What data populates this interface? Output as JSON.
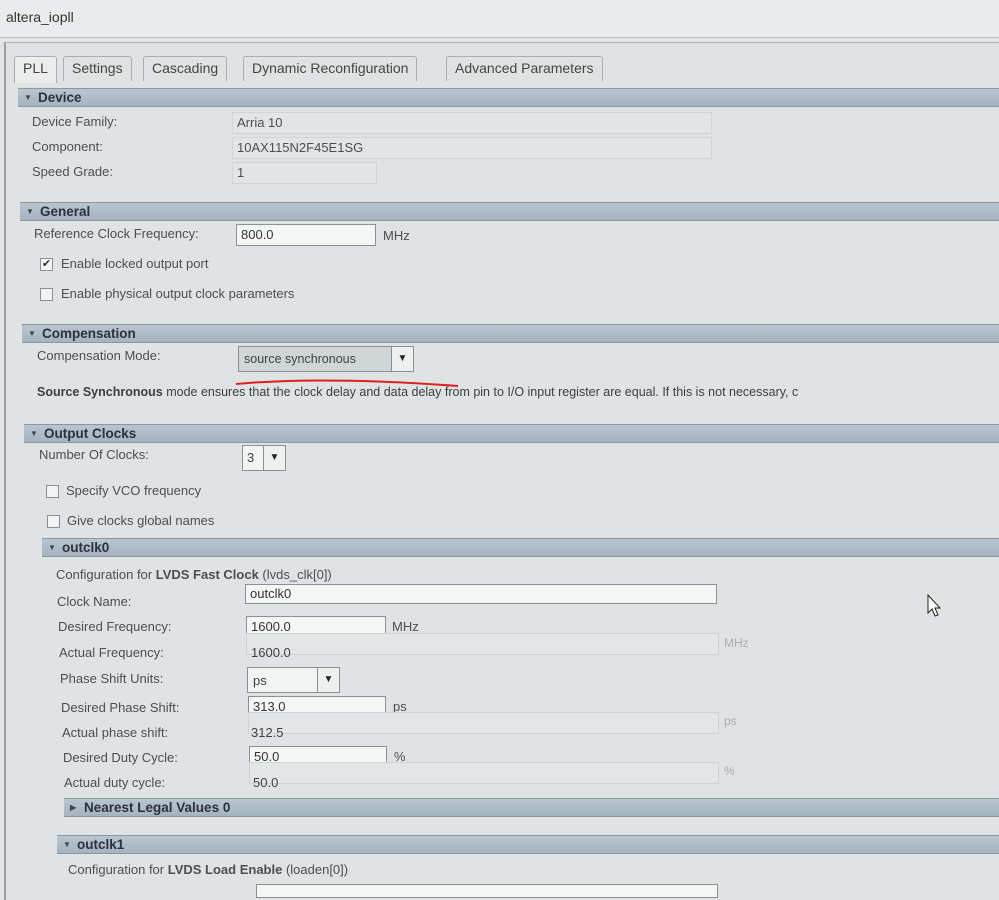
{
  "window": {
    "title": "altera_iopll"
  },
  "tabs": [
    "PLL",
    "Settings",
    "Cascading",
    "Dynamic Reconfiguration",
    "Advanced Parameters"
  ],
  "device": {
    "header": "Device",
    "family_label": "Device Family:",
    "family": "Arria 10",
    "component_label": "Component:",
    "component": "10AX115N2F45E1SG",
    "speed_label": "Speed Grade:",
    "speed": "1"
  },
  "general": {
    "header": "General",
    "ref_label": "Reference Clock Frequency:",
    "ref_value": "800.0",
    "ref_unit": "MHz",
    "locked_label": "Enable locked output port",
    "locked_checked": true,
    "phys_label": "Enable physical output clock parameters",
    "phys_checked": false
  },
  "compensation": {
    "header": "Compensation",
    "mode_label": "Compensation Mode:",
    "mode": "source synchronous",
    "desc_bold": "Source Synchronous",
    "desc": " mode ensures that the clock delay and data delay from pin to I/O input register are equal. If this is not necessary, c",
    "annotation_color": "#e02020"
  },
  "output_clocks": {
    "header": "Output Clocks",
    "num_label": "Number Of Clocks:",
    "num": "3",
    "vco_label": "Specify VCO frequency",
    "global_label": "Give clocks global names"
  },
  "outclk0": {
    "header": "outclk0",
    "config_prefix": "Configuration for ",
    "config_bold": "LVDS Fast Clock",
    "config_suffix": " (lvds_clk[0])",
    "clock_name_label": "Clock Name:",
    "clock_name": "outclk0",
    "desired_freq_label": "Desired Frequency:",
    "desired_freq": "1600.0",
    "mhz": "MHz",
    "actual_freq_label": "Actual Frequency:",
    "actual_freq": "1600.0",
    "phase_units_label": "Phase Shift Units:",
    "phase_units": "ps",
    "desired_phase_label": "Desired Phase Shift:",
    "desired_phase": "313.0",
    "ps": "ps",
    "actual_phase_label": "Actual phase shift:",
    "actual_phase": "312.5",
    "desired_duty_label": "Desired Duty Cycle:",
    "desired_duty": "50.0",
    "pct": "%",
    "actual_duty_label": "Actual duty cycle:",
    "actual_duty": "50.0",
    "nearest_header": "Nearest Legal Values 0"
  },
  "outclk1": {
    "header": "outclk1",
    "config_prefix": "Configuration for ",
    "config_bold": "LVDS Load Enable",
    "config_suffix": " (loaden[0])"
  }
}
